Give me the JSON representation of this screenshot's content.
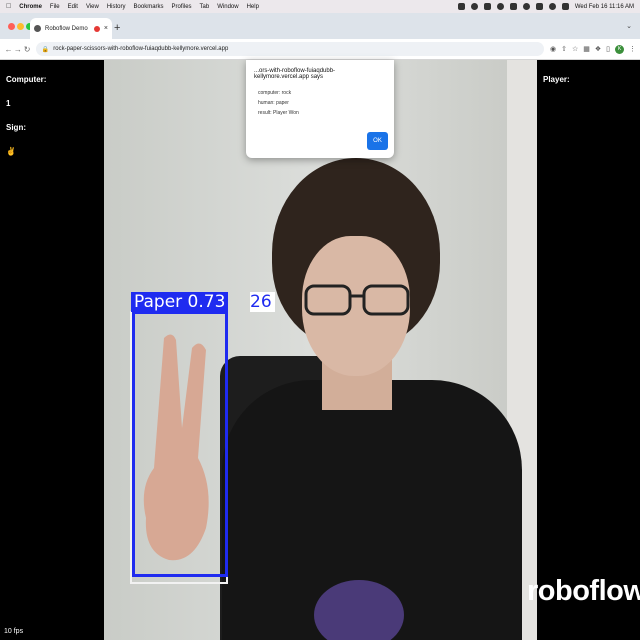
{
  "menubar": {
    "app": "Chrome",
    "items": [
      "File",
      "Edit",
      "View",
      "History",
      "Bookmarks",
      "Profiles",
      "Tab",
      "Window",
      "Help"
    ],
    "clock": "Wed Feb 16  11:16 AM"
  },
  "browser": {
    "tab_title": "Roboflow Demo",
    "new_tab": "+",
    "url": "rock-paper-scissors-with-roboflow-fuiaqdubb-kellymore.vercel.app",
    "profile_initial": "K"
  },
  "left_panel": {
    "computer_label": "Computer:",
    "computer_value": "1",
    "sign_label": "Sign:",
    "sign_value": "✌",
    "fps": "10 fps"
  },
  "right_panel": {
    "player_label": "Player:"
  },
  "detection": {
    "label": "Paper 0.73",
    "label_tail": "26",
    "box_color": "#1f2bf0"
  },
  "watermark": "roboflow",
  "alert": {
    "title": "...ors-with-roboflow-fuiaqdubb-kellymore.vercel.app says",
    "lines": [
      "computer: rock",
      "human: paper",
      "result: Player Won"
    ],
    "ok_label": "OK"
  }
}
